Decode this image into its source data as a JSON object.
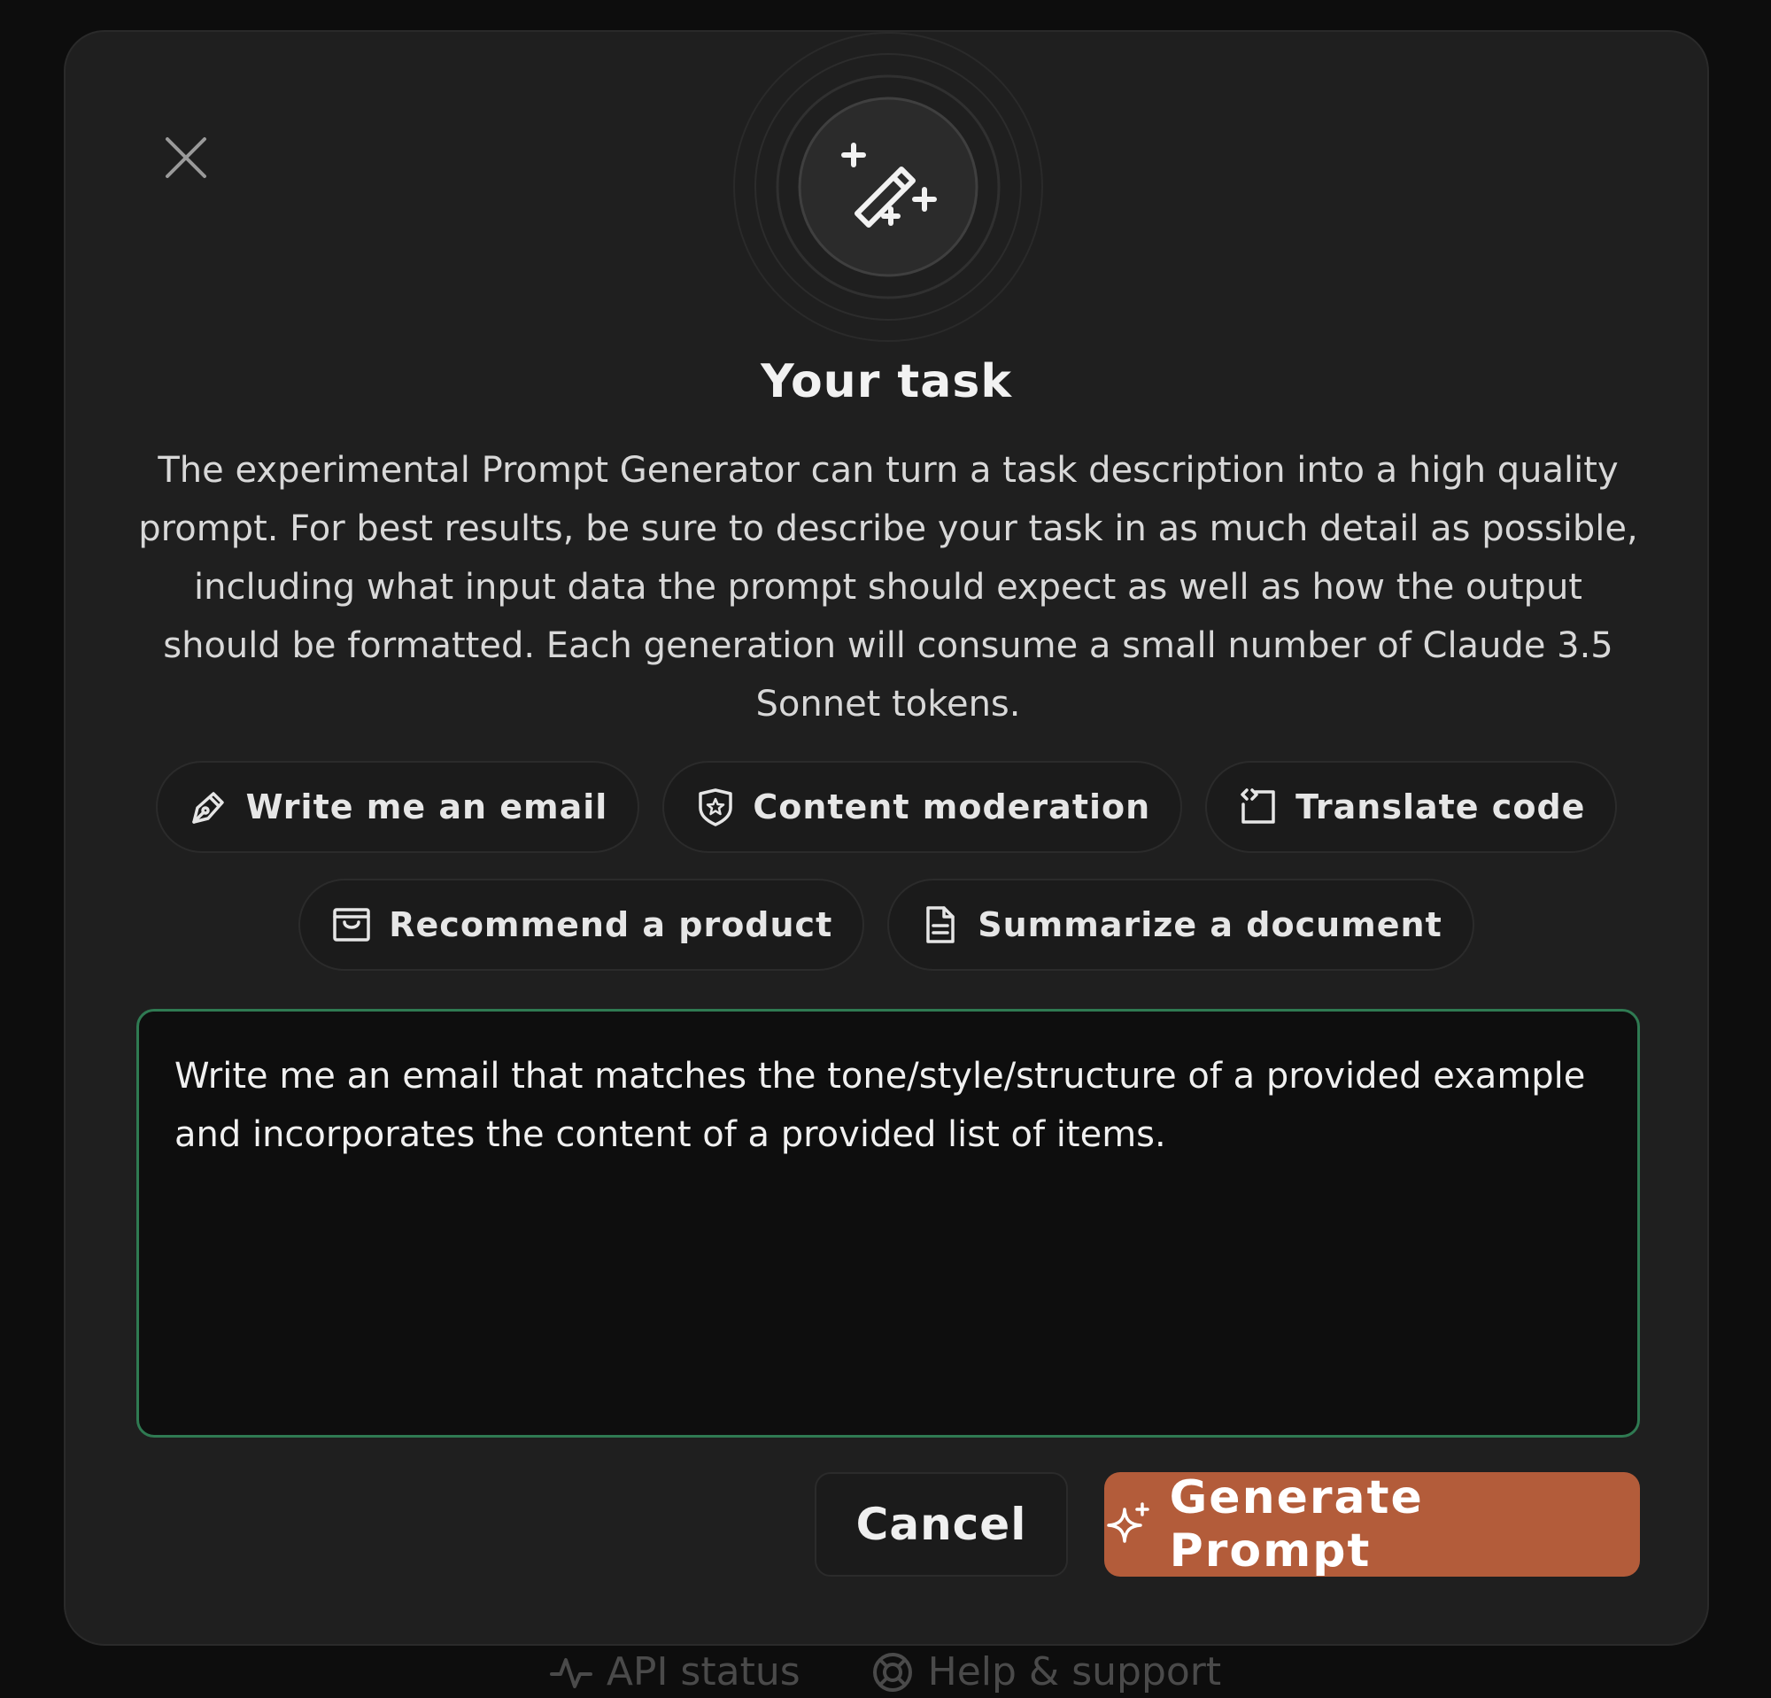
{
  "modal": {
    "title": "Your task",
    "description": "The experimental Prompt Generator can turn a task description into a high quality prompt. For best results, be sure to describe your task in as much detail as possible, including what input data the prompt should expect as well as how the output should be formatted. Each generation will consume a small number of Claude 3.5 Sonnet tokens.",
    "hero_icon": "magic-wand-icon",
    "close_icon": "close-icon"
  },
  "suggestions": [
    {
      "label": "Write me an email",
      "icon": "pen-nib-icon"
    },
    {
      "label": "Content moderation",
      "icon": "shield-star-icon"
    },
    {
      "label": "Translate code",
      "icon": "code-frame-icon"
    },
    {
      "label": "Recommend a product",
      "icon": "shopping-bag-icon"
    },
    {
      "label": "Summarize a document",
      "icon": "document-icon"
    }
  ],
  "task_input": {
    "value": "Write me an email that matches the tone/style/structure of a provided example and incorporates the content of a provided list of items."
  },
  "actions": {
    "cancel_label": "Cancel",
    "generate_label": "Generate Prompt",
    "generate_icon": "sparkle-icon"
  },
  "footer": {
    "api_status": "API status",
    "help": "Help & support"
  },
  "colors": {
    "accent": "#b35c3a",
    "focus_border": "#2f7a52",
    "modal_bg": "#1f1f1f"
  }
}
